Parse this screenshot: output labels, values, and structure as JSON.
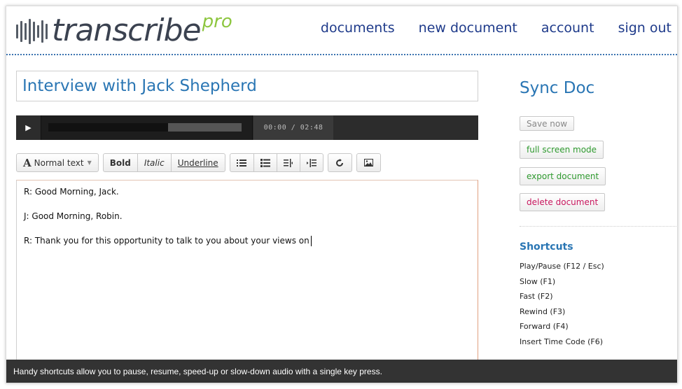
{
  "app": {
    "logo_text": "transcribe",
    "logo_suffix": "pro"
  },
  "nav": {
    "items": [
      "documents",
      "new document",
      "account",
      "sign out"
    ]
  },
  "document": {
    "title": "Interview with Jack Shepherd"
  },
  "player": {
    "time": "00:00 / 02:48",
    "buffered_fraction": 0.62
  },
  "toolbar": {
    "style_select": "Normal text",
    "bold": "Bold",
    "italic": "Italic",
    "underline": "Underline",
    "icons": [
      "unordered-list-icon",
      "ordered-list-icon",
      "outdent-icon",
      "indent-icon",
      "undo-icon",
      "image-icon"
    ]
  },
  "editor": {
    "paragraphs": [
      "R: Good Morning, Jack.",
      "J: Good Morning, Robin.",
      "R: Thank you for this opportunity to talk to you about your views on"
    ]
  },
  "sidebar": {
    "title": "Sync Doc",
    "save_label": "Save now",
    "fullscreen_label": "full screen mode",
    "export_label": "export document",
    "delete_label": "delete document",
    "shortcuts_title": "Shortcuts",
    "shortcuts": [
      "Play/Pause (F12 / Esc)",
      "Slow (F1)",
      "Fast (F2)",
      "Rewind (F3)",
      "Forward (F4)",
      "Insert Time Code (F6)"
    ]
  },
  "caption": {
    "text": "Handy shortcuts allow you to pause, resume, speed-up or slow-down audio with a single key press."
  },
  "colors": {
    "accent_blue": "#2a76b4",
    "nav_blue": "#1e3a8a",
    "logo_green": "#8dc63f",
    "action_green": "#2f9a2f",
    "delete_red": "#c8175e"
  }
}
